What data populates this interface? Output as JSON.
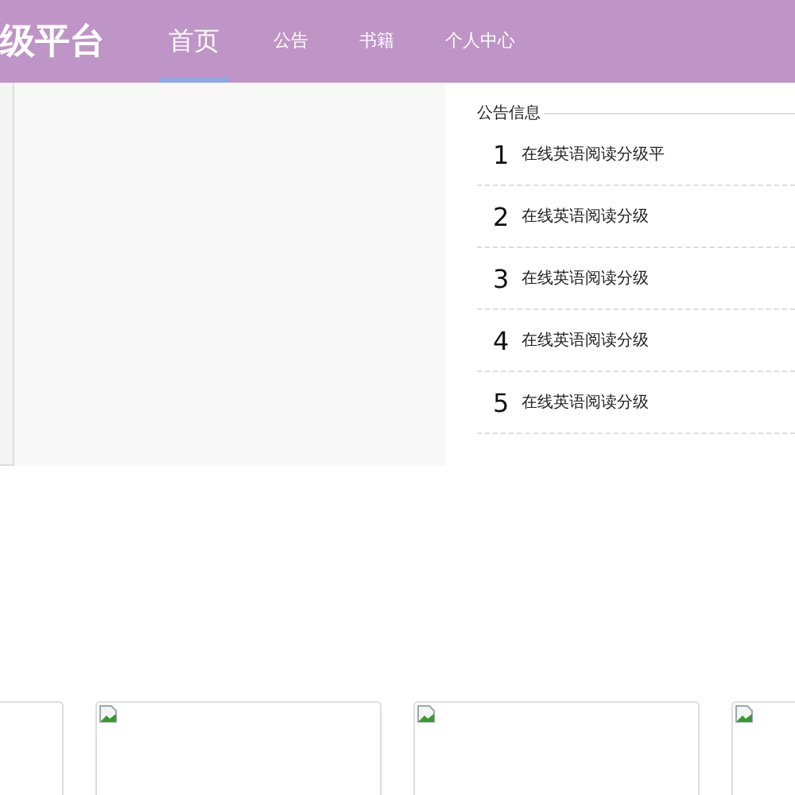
{
  "header": {
    "logo": "级平台",
    "nav": [
      {
        "label": "首页",
        "selected": true
      },
      {
        "label": "公告",
        "selected": false
      },
      {
        "label": "书籍",
        "selected": false
      },
      {
        "label": "个人中心",
        "selected": false
      }
    ]
  },
  "notices": {
    "title": "公告信息",
    "items": [
      {
        "number": "1",
        "text": "在线英语阅读分级平"
      },
      {
        "number": "2",
        "text": "在线英语阅读分级"
      },
      {
        "number": "3",
        "text": "在线英语阅读分级"
      },
      {
        "number": "4",
        "text": "在线英语阅读分级"
      },
      {
        "number": "5",
        "text": "在线英语阅读分级"
      }
    ]
  },
  "cards": [
    {
      "kind": "blank"
    },
    {
      "kind": "broken-image"
    },
    {
      "kind": "broken-image"
    },
    {
      "kind": "broken-image"
    }
  ]
}
